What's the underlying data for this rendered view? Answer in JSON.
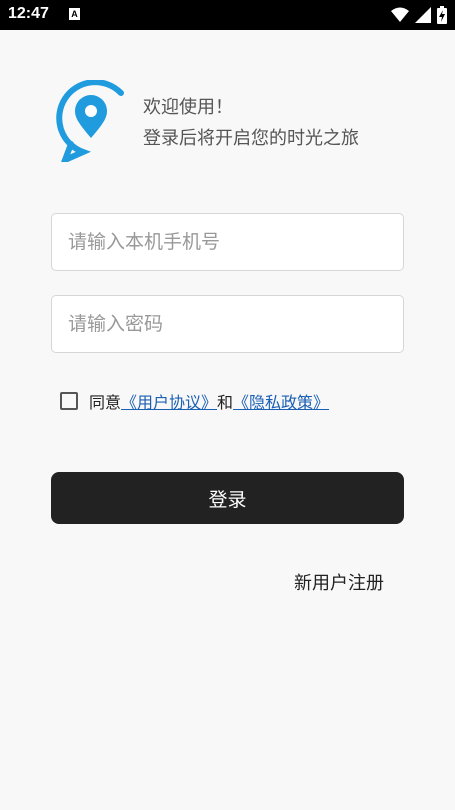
{
  "status_bar": {
    "time": "12:47",
    "notification_icon_label": "A",
    "icons": [
      "wifi-icon",
      "signal-icon",
      "battery-charging-icon"
    ]
  },
  "header": {
    "logo_icon": "location-chat-icon",
    "welcome_line1": "欢迎使用！",
    "welcome_line2": "登录后将开启您的时光之旅"
  },
  "form": {
    "phone_placeholder": "请输入本机手机号",
    "phone_value": "",
    "password_placeholder": "请输入密码",
    "password_value": ""
  },
  "agreement": {
    "checked": false,
    "prefix": "同意",
    "user_agreement": "《用户协议》",
    "and": "和",
    "privacy_policy": "《隐私政策》"
  },
  "actions": {
    "login_label": "登录",
    "register_label": "新用户注册"
  },
  "colors": {
    "accent": "#1f9bde",
    "link": "#1a5fb4",
    "button": "#222222",
    "background": "#f8f8f8"
  }
}
